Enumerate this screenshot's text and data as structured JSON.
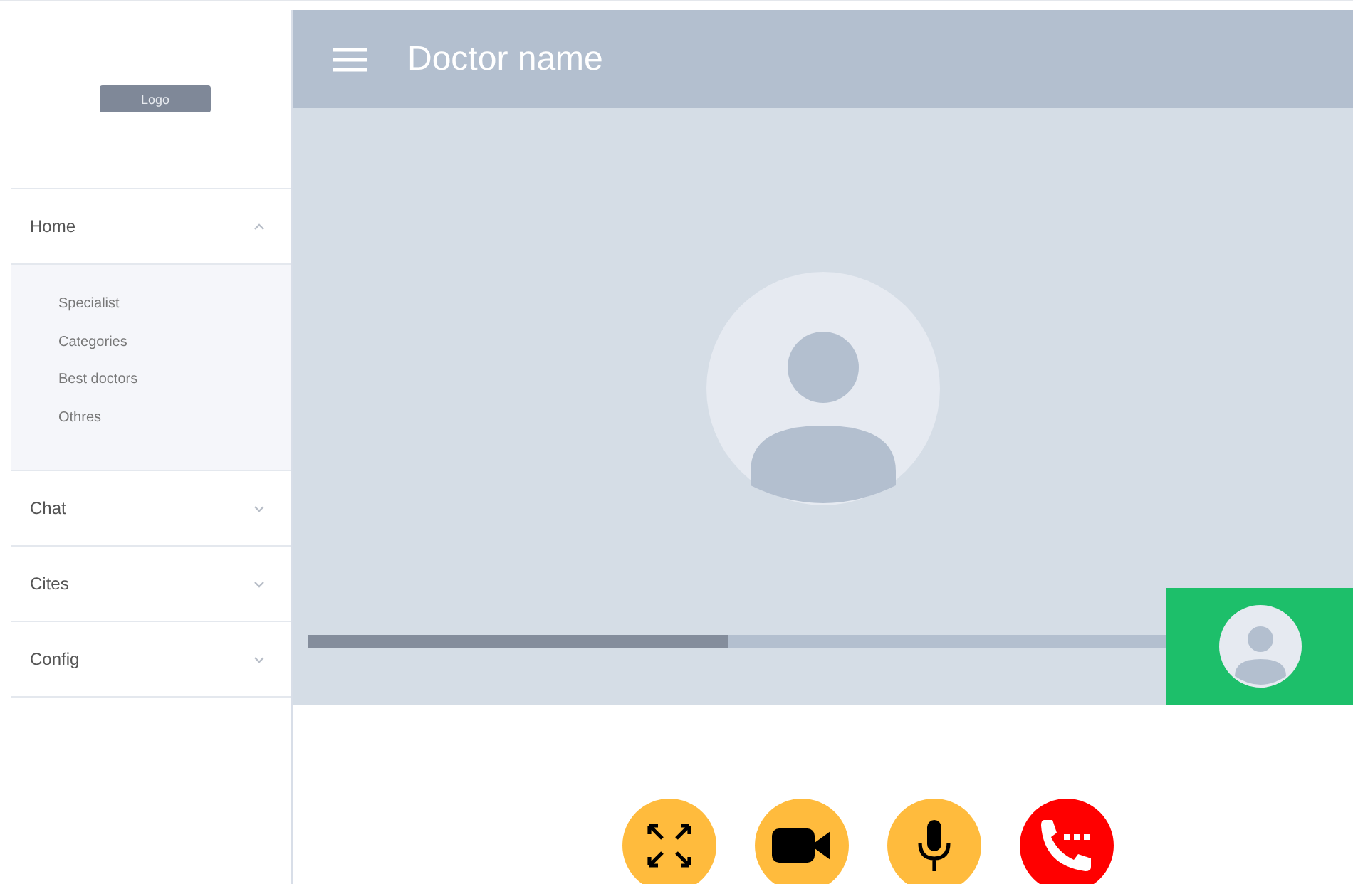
{
  "sidebar": {
    "logo": "Logo",
    "items": [
      {
        "label": "Home",
        "expanded": true,
        "children": [
          {
            "label": "Specialist"
          },
          {
            "label": "Categories"
          },
          {
            "label": "Best doctors"
          },
          {
            "label": "Othres"
          }
        ]
      },
      {
        "label": "Chat",
        "expanded": false
      },
      {
        "label": "Cites",
        "expanded": false
      },
      {
        "label": "Config",
        "expanded": false
      }
    ]
  },
  "header": {
    "title": "Doctor name"
  },
  "video": {
    "progress": {
      "level": 0.49
    }
  },
  "controls": [
    {
      "kind": "fullscreen"
    },
    {
      "kind": "camera"
    },
    {
      "kind": "microphone"
    },
    {
      "kind": "end-call"
    }
  ]
}
